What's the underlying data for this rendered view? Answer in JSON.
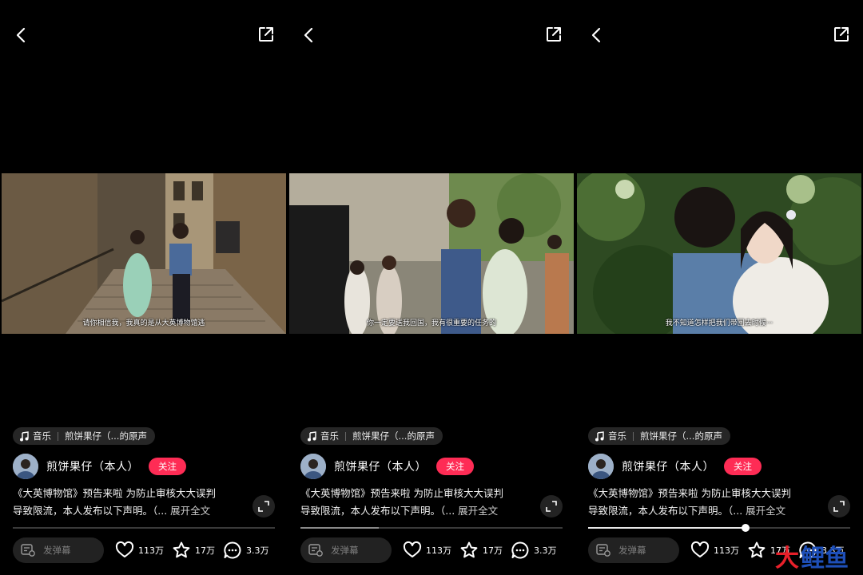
{
  "panels": [
    {
      "subtitle": "请你相信我，我真的是从大英博物馆逃",
      "progress_pct": 0,
      "show_progress_thumb": false
    },
    {
      "subtitle": "你一定要送我回国，我有很重要的任务的",
      "progress_pct": 30,
      "show_progress_thumb": false
    },
    {
      "subtitle": "我不知道怎样把我们带回去时候···",
      "progress_pct": 60,
      "show_progress_thumb": true
    }
  ],
  "music": {
    "label": "音乐",
    "source": "煎饼果仔（...的原声"
  },
  "author": {
    "name": "煎饼果仔（本人）",
    "follow_label": "关注"
  },
  "description": {
    "line1": "《大英博物馆》预告来啦 为防止审核大大误判",
    "line2": "导致限流，本人发布以下声明。（...",
    "expand_label": "展开全文"
  },
  "bottom_bar": {
    "danmu_placeholder": "发弹幕",
    "likes": "113万",
    "favorites": "17万",
    "comments": "3.3万"
  },
  "watermark": {
    "char1": "大",
    "char2": "鲤鱼"
  },
  "colors": {
    "background": "#000000",
    "follow_button": "#fe2c55",
    "chip_background": "#262626"
  },
  "icons": [
    "back-arrow-icon",
    "share-icon",
    "music-note-icon",
    "fullscreen-icon",
    "danmu-icon",
    "heart-icon",
    "star-icon",
    "comment-icon"
  ]
}
